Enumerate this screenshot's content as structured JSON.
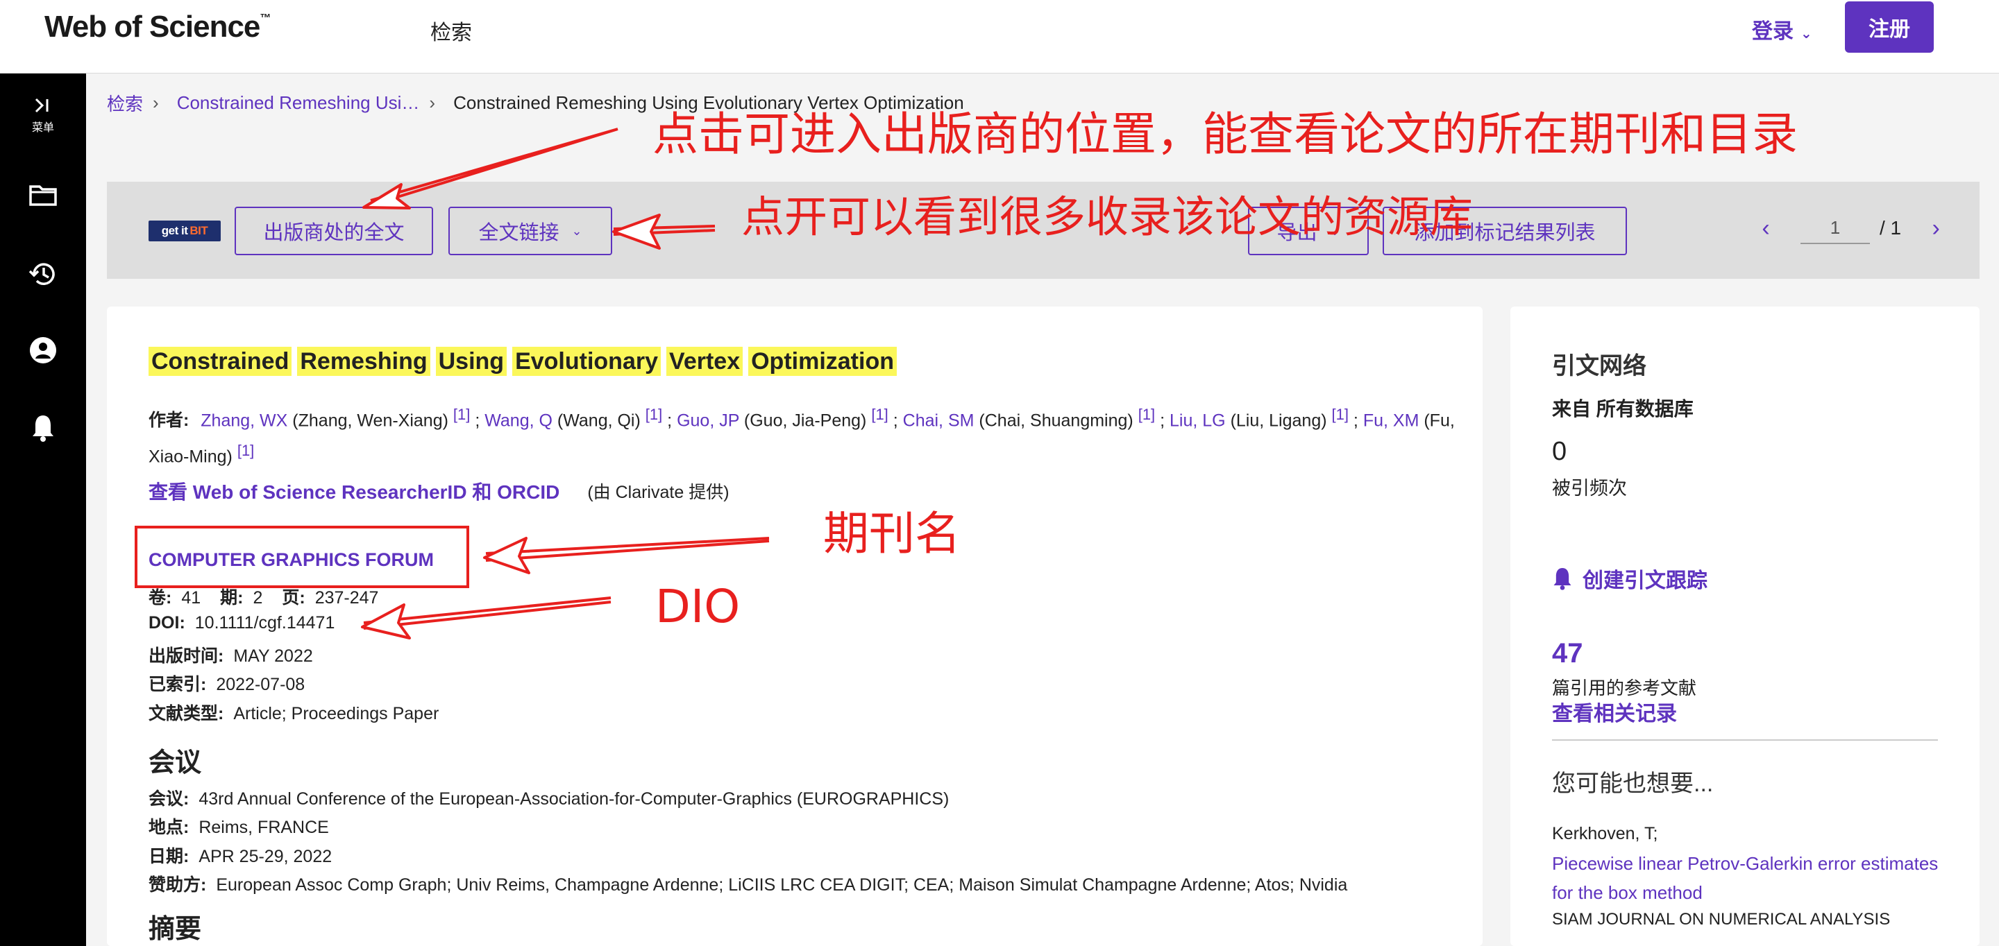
{
  "header": {
    "logo_text": "Web of Science",
    "logo_tm": "™",
    "nav_search": "检索",
    "login_label": "登录",
    "register_label": "注册"
  },
  "rail": {
    "menu_label": "菜单",
    "items": [
      "menu-expand-icon",
      "folder-icon",
      "history-icon",
      "account-icon",
      "bell-icon"
    ]
  },
  "breadcrumb": {
    "items": [
      "检索",
      "Constrained Remeshing Usi…",
      "Constrained Remeshing Using Evolutionary Vertex Optimization"
    ]
  },
  "toolbar": {
    "getit_text": "get it",
    "getit_brand": "BIT",
    "publisher_fulltext": "出版商处的全文",
    "fulltext_links": "全文链接",
    "export": "导出",
    "add_to_marked": "添加到标记结果列表",
    "page_current": "1",
    "page_total": "/ 1"
  },
  "record": {
    "title_words": [
      "Constrained",
      "Remeshing",
      "Using",
      "Evolutionary",
      "Vertex",
      "Optimization"
    ],
    "authors_label": "作者:",
    "authors": [
      {
        "short": "Zhang, WX",
        "full": "(Zhang, Wen-Xiang)",
        "aff": "[1]"
      },
      {
        "short": "Wang, Q",
        "full": "(Wang, Qi)",
        "aff": "[1]"
      },
      {
        "short": "Guo, JP",
        "full": "(Guo, Jia-Peng)",
        "aff": "[1]"
      },
      {
        "short": "Chai, SM",
        "full": "(Chai, Shuangming)",
        "aff": "[1]"
      },
      {
        "short": "Liu, LG",
        "full": "(Liu, Ligang)",
        "aff": "[1]"
      },
      {
        "short": "Fu, XM",
        "full": "(Fu, Xiao-Ming)",
        "aff": "[1]"
      }
    ],
    "researcher_link": "查看 Web of Science ResearcherID 和 ORCID",
    "researcher_provider": "(由 Clarivate 提供)",
    "journal": "COMPUTER GRAPHICS FORUM",
    "volume_label": "卷:",
    "volume": "41",
    "issue_label": "期:",
    "issue": "2",
    "pages_label": "页:",
    "pages": "237-247",
    "doi_label": "DOI:",
    "doi": "10.1111/cgf.14471",
    "published_label": "出版时间:",
    "published": "MAY 2022",
    "indexed_label": "已索引:",
    "indexed": "2022-07-08",
    "doctype_label": "文献类型:",
    "doctype": "Article; Proceedings Paper",
    "conference_heading": "会议",
    "conf_label": "会议:",
    "conf": "43rd Annual Conference of the European-Association-for-Computer-Graphics (EUROGRAPHICS)",
    "location_label": "地点:",
    "location": "Reims, FRANCE",
    "date_label": "日期:",
    "date": "APR 25-29, 2022",
    "sponsor_label": "赞助方:",
    "sponsor": "European Assoc Comp Graph; Univ Reims, Champagne Ardenne; LiCIIS LRC CEA DIGIT; CEA; Maison Simulat Champagne Ardenne; Atos; Nvidia",
    "abstract_heading": "摘要"
  },
  "sidebar": {
    "heading": "引文网络",
    "source": "来自 所有数据库",
    "citation_count": "0",
    "citation_label": "被引频次",
    "alert_label": "创建引文跟踪",
    "refs_count": "47",
    "refs_label": "篇引用的参考文献",
    "refs_link": "查看相关记录",
    "may_like": "您可能也想要...",
    "rec_author": "Kerkhoven, T;",
    "rec_title": "Piecewise linear Petrov-Galerkin error estimates for the box method",
    "rec_journal": "SIAM JOURNAL ON NUMERICAL ANALYSIS"
  },
  "annotations": {
    "publisher_note": "点击可进入出版商的位置，能查看论文的所在期刊和目录",
    "links_note": "点开可以看到很多收录该论文的资源库",
    "journal_note": "期刊名",
    "doi_note": "DIO",
    "color": "#e8201e"
  },
  "colors": {
    "brand": "#5e33bf",
    "highlight": "#fbf75a",
    "rail": "#000000"
  }
}
